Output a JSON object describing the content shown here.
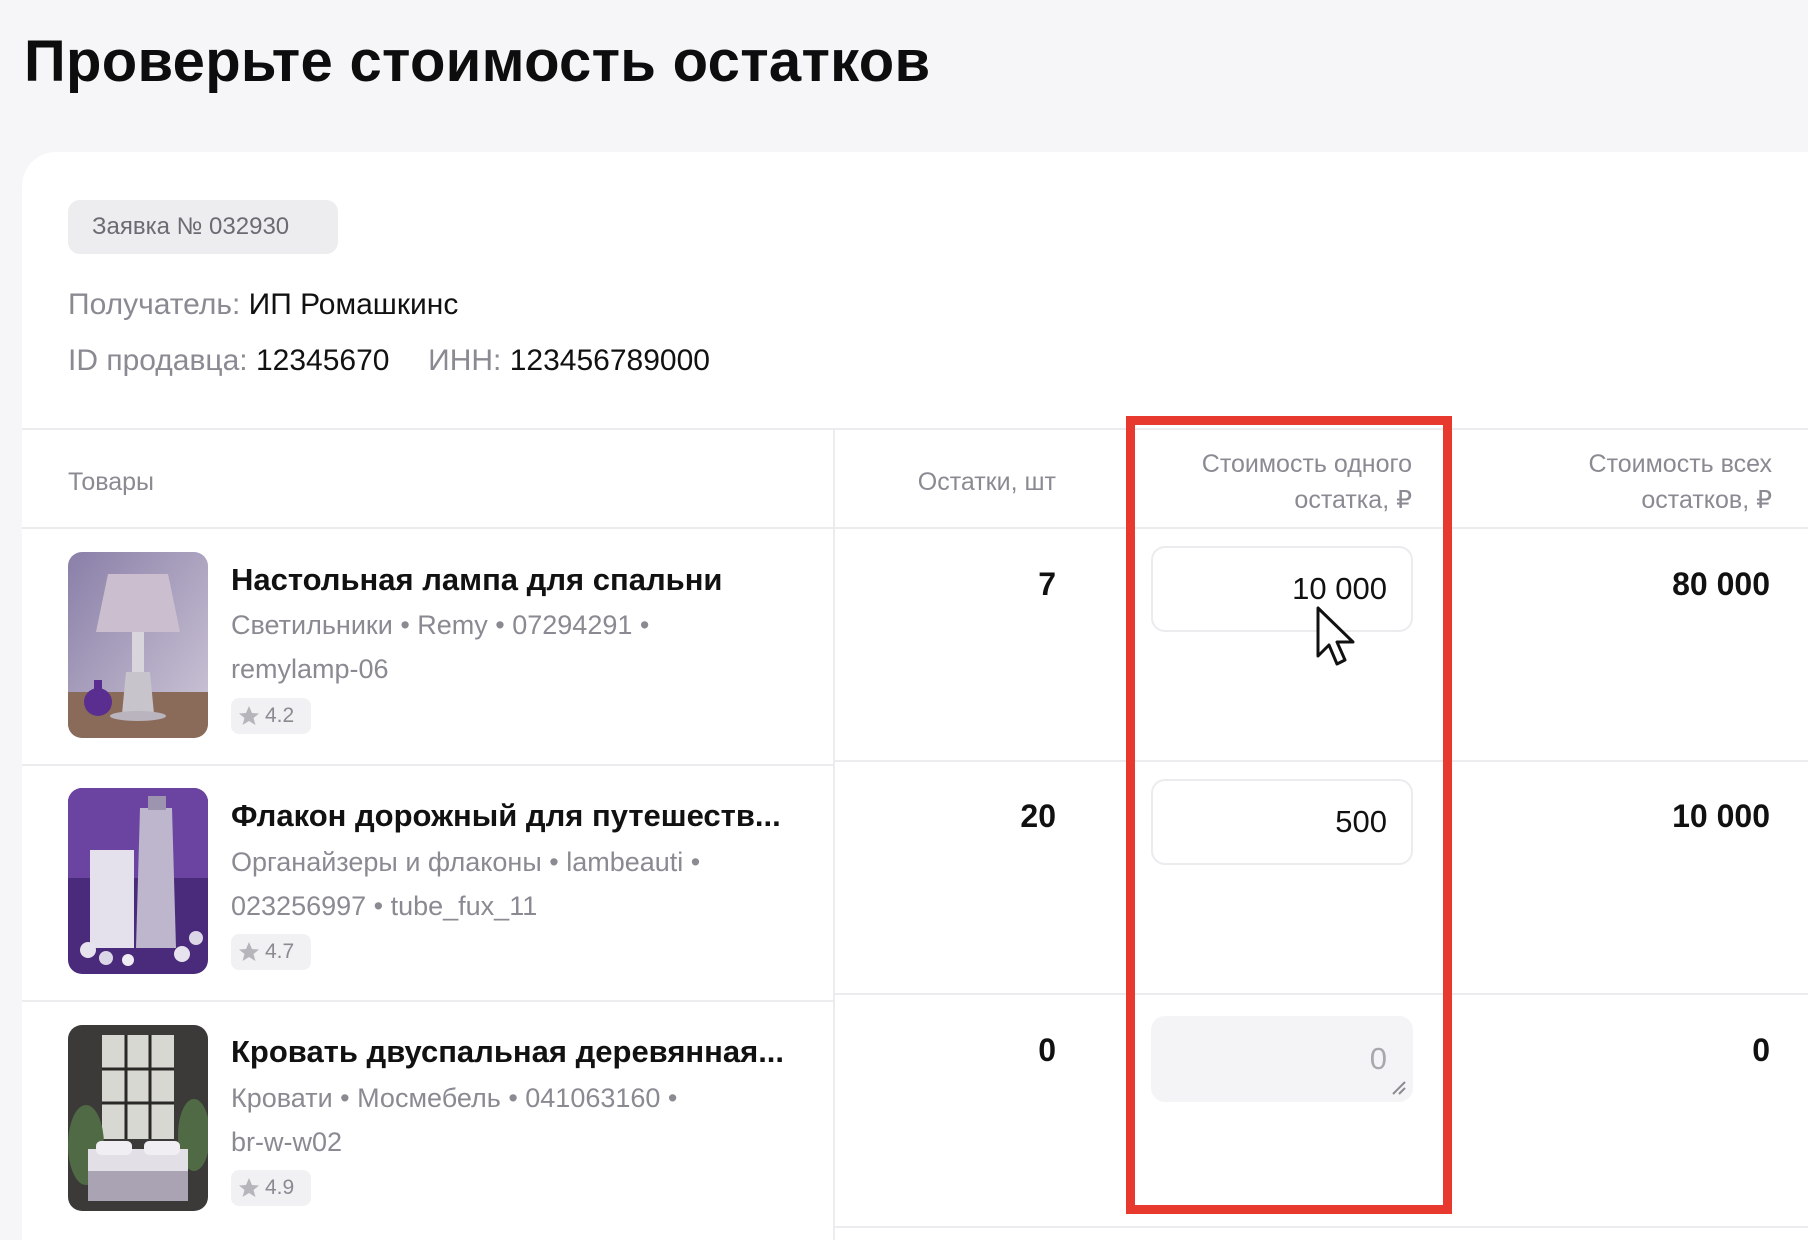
{
  "page_title": "Проверьте стоимость остатков",
  "order": {
    "badge": "Заявка № 032930"
  },
  "recipient": {
    "label": "Получатель:",
    "value": "ИП Ромашкинс"
  },
  "seller": {
    "id_label": "ID продавца:",
    "id_value": "12345670",
    "inn_label": "ИНН:",
    "inn_value": "123456789000"
  },
  "table": {
    "headers": {
      "products": "Товары",
      "stock": "Остатки, шт",
      "unit_cost_line1": "Стоимость одного",
      "unit_cost_line2": "остатка, ₽",
      "total_cost_line1": "Стоимость всех",
      "total_cost_line2": "остатков, ₽"
    },
    "rows": [
      {
        "name": "Настольная лампа для спальни",
        "meta_line1": "Светильники • Remy • 07294291 •",
        "meta_line2": "remylamp-06",
        "rating": "4.2",
        "stock": "7",
        "unit_cost": "10 000",
        "total": "80 000"
      },
      {
        "name": "Флакон дорожный для путешеств...",
        "meta_line1": "Органайзеры и флаконы • lambeauti •",
        "meta_line2": "023256997 • tube_fux_11",
        "rating": "4.7",
        "stock": "20",
        "unit_cost": "500",
        "total": "10 000"
      },
      {
        "name": "Кровать двуспальная деревянная...",
        "meta_line1": "Кровати • Мосмебель • 041063160 •",
        "meta_line2": "br-w-w02",
        "rating": "4.9",
        "stock": "0",
        "unit_cost": "0",
        "total": "0"
      }
    ]
  },
  "colors": {
    "highlight": "#e8392e",
    "muted_text": "#8a8a92",
    "background": "#f6f6f8"
  },
  "icons": {
    "rating": "star-icon",
    "cursor": "mouse-pointer-icon",
    "resize": "resize-grip-icon"
  }
}
